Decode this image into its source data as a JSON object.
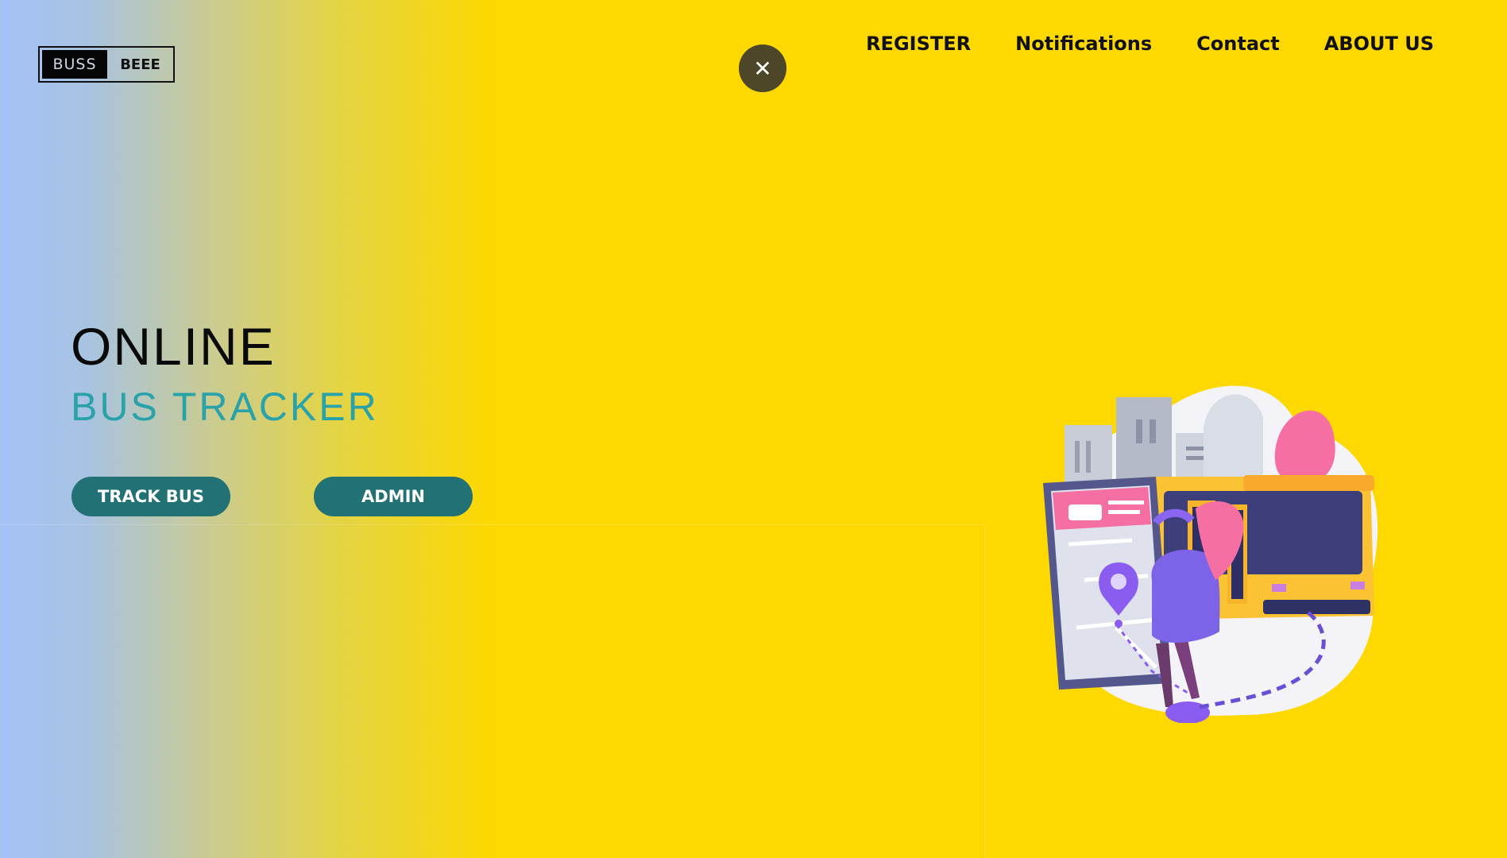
{
  "logo": {
    "left_text": "BUSS",
    "right_text": "BEEE"
  },
  "close_button": {
    "icon": "close-icon",
    "glyph": "✕"
  },
  "nav": {
    "items": [
      {
        "label": "REGISTER"
      },
      {
        "label": "Notifications"
      },
      {
        "label": "Contact"
      },
      {
        "label": "ABOUT US"
      }
    ]
  },
  "hero": {
    "title": "ONLINE",
    "subtitle": "BUS TRACKER",
    "track_button": "TRACK BUS",
    "admin_button": "ADMIN"
  },
  "colors": {
    "background": "#fdd801",
    "gradient_start": "#a4c2f7",
    "button": "#227174",
    "subtitle": "#2aa2a9",
    "close_button": "#4d4629"
  }
}
